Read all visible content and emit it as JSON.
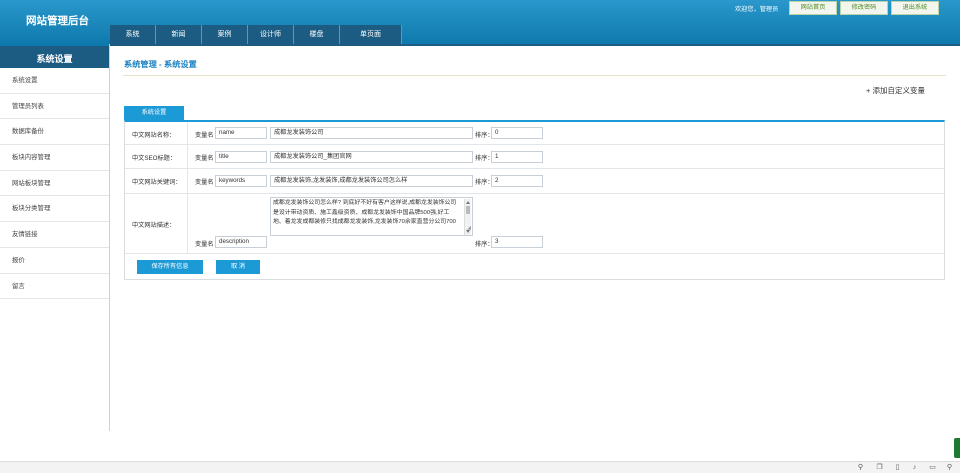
{
  "app": {
    "title": "网站管理后台"
  },
  "header": {
    "welcome": "欢迎您，管理员",
    "buttons": [
      "网站首页",
      "修改密码",
      "退出系统"
    ]
  },
  "nav": [
    "系统",
    "新闻",
    "案例",
    "设计师",
    "楼盘",
    "单页面"
  ],
  "sidebar": {
    "title": "系统设置",
    "items": [
      "系统设置",
      "管理员列表",
      "数据库备份",
      "板块内容管理",
      "网站板块管理",
      "板块分类管理",
      "友情链接",
      "报价",
      "留言"
    ]
  },
  "main": {
    "breadcrumb": "系统管理 - 系统设置",
    "add_var": "+ 添加自定义变量",
    "tab": "系统设置",
    "var_label": "变量名",
    "sort_label": "排序：",
    "rows": [
      {
        "label": "中文网站名称：",
        "var": "name",
        "value": "成都龙发装饰公司",
        "sort": "0"
      },
      {
        "label": "中文SEO标题：",
        "var": "title",
        "value": "成都龙发装饰公司_集团官网",
        "sort": "1"
      },
      {
        "label": "中文网站关键词：",
        "var": "keywords",
        "value": "成都龙发装饰,龙发装饰,成都龙发装饰公司怎么样",
        "sort": "2"
      },
      {
        "label": "中文网站描述：",
        "var": "description",
        "value": "成都龙发装饰公司怎么样? 到底好不好有客户这样说,成都龙发装饰公司是设计带动资质、施工鑫级资质、成都龙发装饰中国品牌500强,好工地、着龙发成都装修只找成都龙发装饰,龙发装饰70余家直营分公司700",
        "sort": "3"
      }
    ],
    "save_label": "保存所有信息",
    "cancel_label": "取 消"
  },
  "taskbar": {
    "icons": [
      "pin-icon",
      "copy-icon",
      "trash-icon",
      "volume-icon",
      "chat-icon",
      "search-icon"
    ]
  },
  "colors": {
    "topbar": "#1a8bc0",
    "nav": "#1c5c82",
    "accent": "#1c9ad6",
    "top_btn_text": "#4f8a25"
  }
}
